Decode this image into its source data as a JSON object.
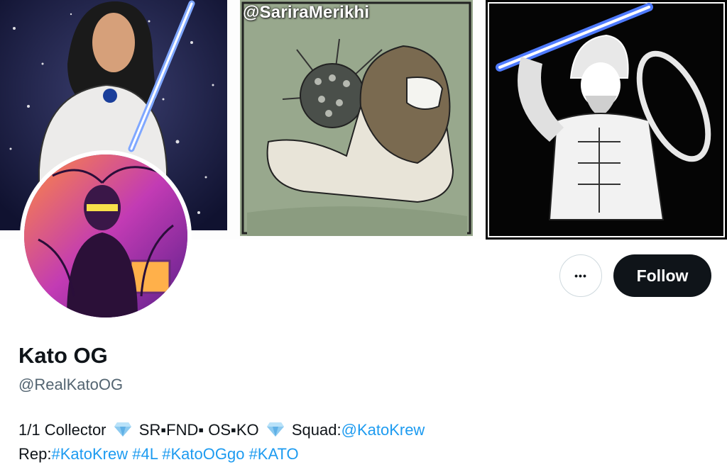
{
  "banner": {
    "watermark": "@SariraMerikhi",
    "panels": [
      "astronaut-with-lightsaber",
      "lion-wearing-mask",
      "warrior-with-lightsaber"
    ]
  },
  "actions": {
    "more_label": "•••",
    "follow_label": "Follow"
  },
  "profile": {
    "name": "Kato OG",
    "handle": "@RealKatoOG"
  },
  "bio": {
    "line1": {
      "collector": "1/1 Collector",
      "ranks": "SR▪FND▪ OS▪KO",
      "squad_label": "Squad:",
      "squad_link": "@KatoKrew"
    },
    "line2": {
      "rep_label": "Rep:",
      "tags": [
        "#KatoKrew",
        "#4L",
        "#KatoOGgo",
        "#KATO"
      ]
    },
    "gem_icon": "gem-stone-emoji"
  },
  "colors": {
    "link": "#1d9bf0",
    "follow_bg": "#0f1419",
    "handle": "#536471"
  }
}
